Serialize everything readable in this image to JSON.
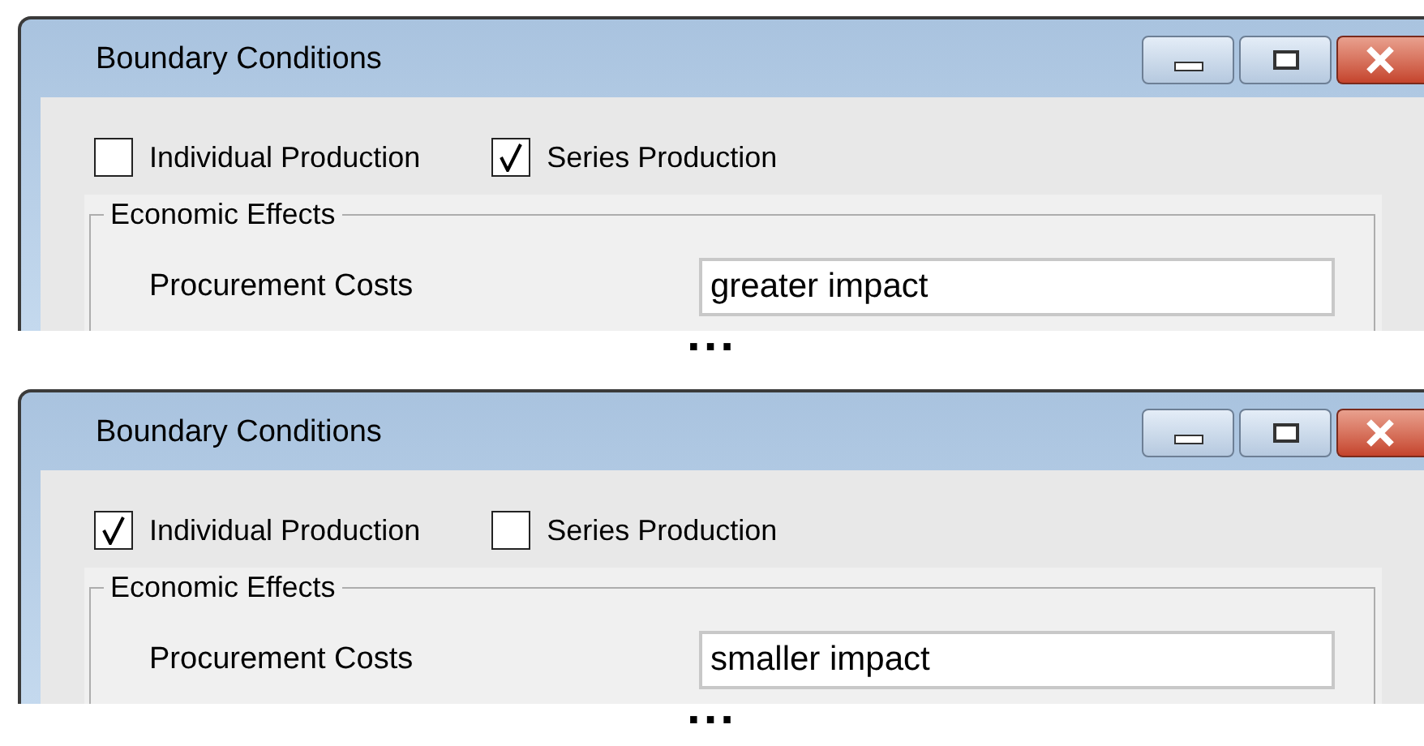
{
  "snippets": [
    {
      "window": {
        "title": "Boundary Conditions"
      },
      "options": [
        {
          "label": "Individual Production",
          "checked": false
        },
        {
          "label": "Series Production",
          "checked": true
        }
      ],
      "group": {
        "title": "Economic Effects",
        "fields": [
          {
            "label": "Procurement Costs",
            "value": "greater impact"
          }
        ]
      },
      "ellipsis": "..."
    },
    {
      "window": {
        "title": "Boundary Conditions"
      },
      "options": [
        {
          "label": "Individual Production",
          "checked": true
        },
        {
          "label": "Series Production",
          "checked": false
        }
      ],
      "group": {
        "title": "Economic Effects",
        "fields": [
          {
            "label": "Procurement Costs",
            "value": "smaller impact"
          }
        ]
      },
      "ellipsis": "..."
    }
  ]
}
